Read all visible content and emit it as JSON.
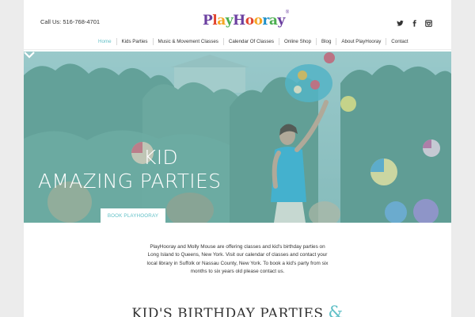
{
  "header": {
    "phone": "Call Us: 516-768-4701",
    "logo_text": "PlayHooray",
    "logo_letters": [
      "P",
      "l",
      "a",
      "y",
      "H",
      "o",
      "o",
      "r",
      "a",
      "y"
    ],
    "logo_colors": [
      "#6b3fa0",
      "#e2452f",
      "#f5a623",
      "#4caf50",
      "#6b3fa0",
      "#e2452f",
      "#f5a623",
      "#1e90c8",
      "#4caf50",
      "#6b3fa0"
    ],
    "logo_reg": "®",
    "social": [
      "twitter-icon",
      "facebook-icon",
      "instagram-icon"
    ]
  },
  "nav": {
    "items": [
      "Home",
      "Kids Parties",
      "Music & Movement Classes",
      "Calendar Of Classes",
      "Online Shop",
      "Blog",
      "About PlayHooray",
      "Contact"
    ],
    "active_index": 0
  },
  "hero": {
    "title_line1": "KID",
    "title_line2": "AMAZING PARTIES",
    "button_label": "BOOK PLAYHOORAY"
  },
  "intro": {
    "text": "PlayHooray and Molly Mouse are offering classes and kid's birthday parties on Long Island to Queens, New York.  Visit our calendar of classes and contact your local library in Suffolk or Nassau County, New York. To book a kid's party from six months to six years old please contact us."
  },
  "section": {
    "heading": "KID'S BIRTHDAY PARTIES",
    "amp": "&"
  },
  "colors": {
    "accent": "#61c0c7",
    "text": "#333333",
    "background": "#ececec",
    "hero_overlay": "#7fb4b4"
  }
}
